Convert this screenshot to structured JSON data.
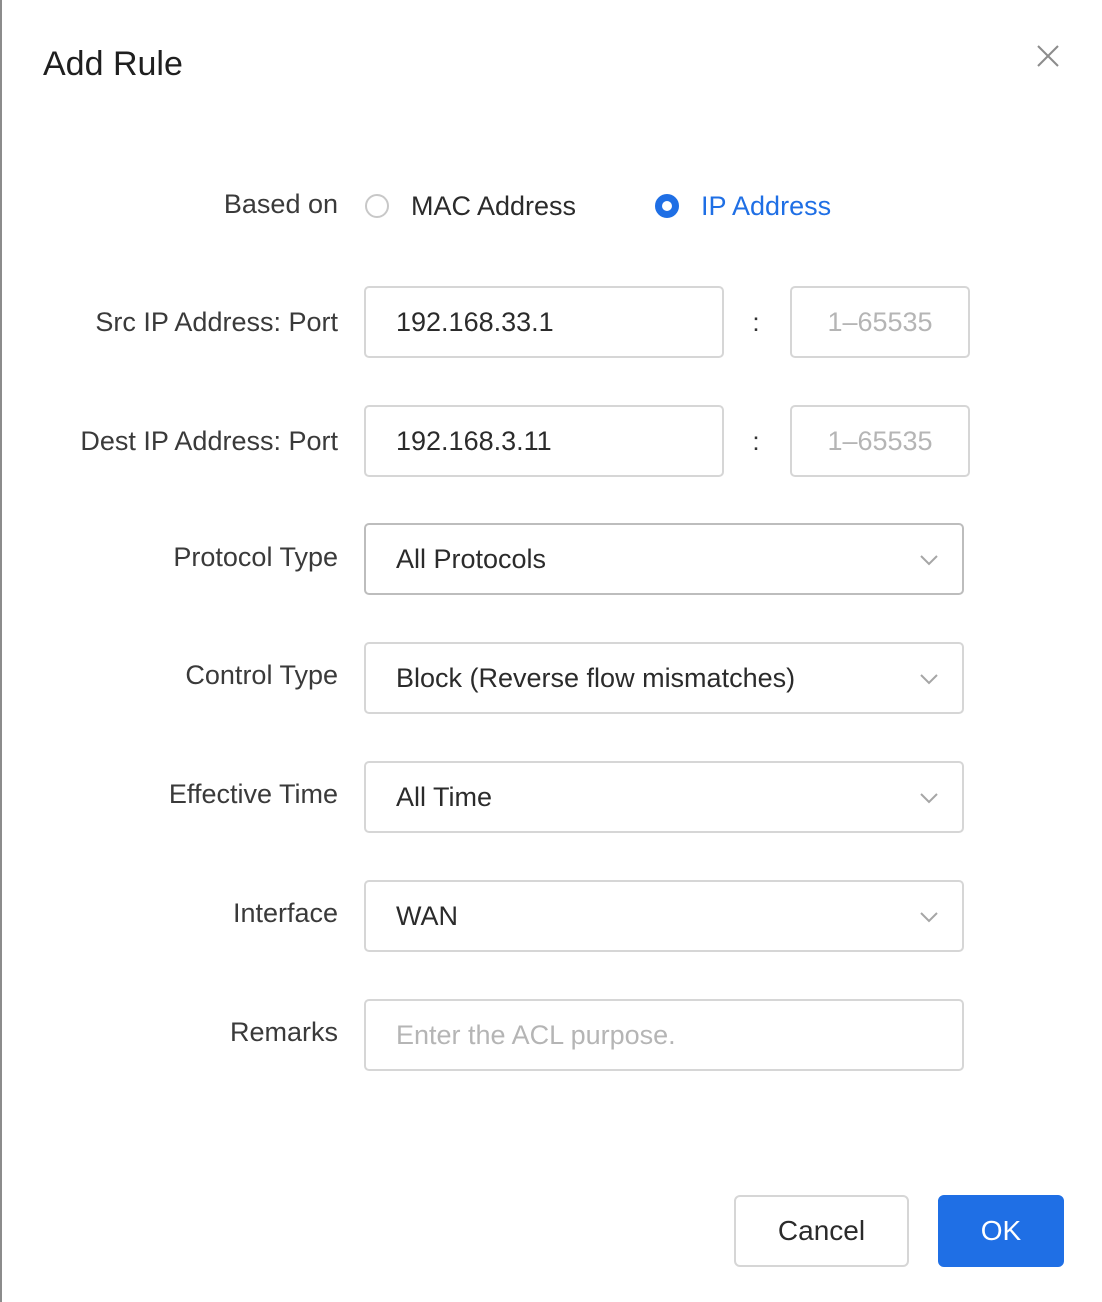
{
  "dialog": {
    "title": "Add Rule"
  },
  "form": {
    "based_on": {
      "label": "Based on",
      "options": [
        {
          "label": "MAC Address",
          "checked": false
        },
        {
          "label": "IP Address",
          "checked": true
        }
      ]
    },
    "src": {
      "label": "Src IP Address: Port",
      "ip_value": "192.168.33.1",
      "separator": ":",
      "port_placeholder": "1–65535"
    },
    "dest": {
      "label": "Dest IP Address: Port",
      "ip_value": "192.168.3.11",
      "separator": ":",
      "port_placeholder": "1–65535"
    },
    "protocol_type": {
      "label": "Protocol Type",
      "value": "All Protocols"
    },
    "control_type": {
      "label": "Control Type",
      "value": "Block (Reverse flow mismatches)"
    },
    "effective_time": {
      "label": "Effective Time",
      "value": "All Time"
    },
    "interface": {
      "label": "Interface",
      "value": "WAN"
    },
    "remarks": {
      "label": "Remarks",
      "placeholder": "Enter the ACL purpose."
    }
  },
  "buttons": {
    "cancel": "Cancel",
    "ok": "OK"
  },
  "colors": {
    "accent": "#1f6fe5",
    "border": "#d6d6d6",
    "placeholder": "#b5b5b5"
  },
  "icons": {
    "close": "close-icon",
    "dropdown": "chevron-down-icon"
  }
}
